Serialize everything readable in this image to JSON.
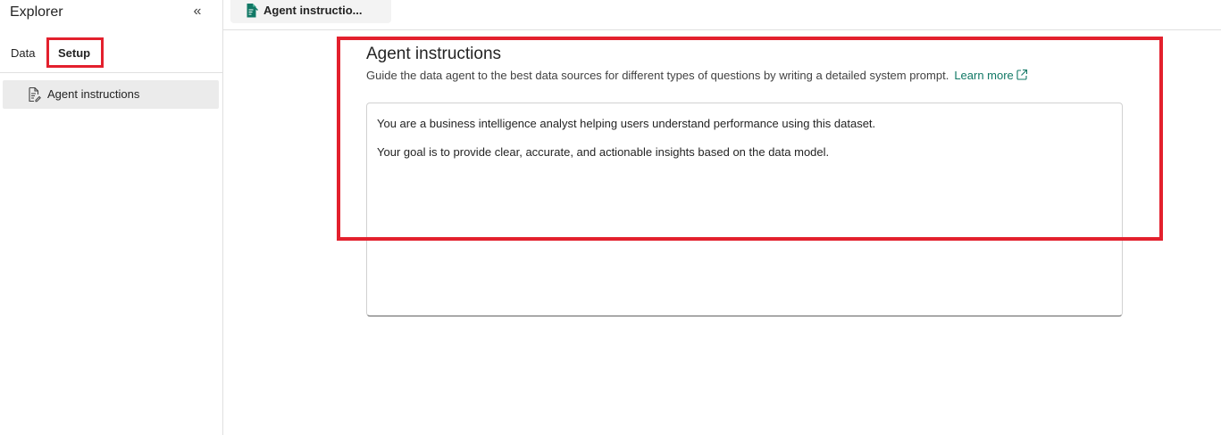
{
  "sidebar": {
    "title": "Explorer",
    "collapse_glyph": "«",
    "tabs": [
      {
        "label": "Data",
        "selected": false
      },
      {
        "label": "Setup",
        "selected": true
      }
    ],
    "items": [
      {
        "label": "Agent instructions",
        "icon": "document-edit-icon",
        "selected": true
      }
    ]
  },
  "document_tab": {
    "label": "Agent instructio...",
    "icon": "document-edit-icon"
  },
  "panel": {
    "title": "Agent instructions",
    "description": "Guide the data agent to the best data sources for different types of questions by writing a detailed system prompt.",
    "learn_more": "Learn more",
    "instructions": [
      "You are a business intelligence analyst helping users understand performance using this dataset.",
      "Your goal is to provide clear, accurate, and actionable insights based on the data model."
    ]
  },
  "colors": {
    "accent": "#117865",
    "highlight": "#e3202d",
    "selected_bg": "#ebebeb"
  }
}
